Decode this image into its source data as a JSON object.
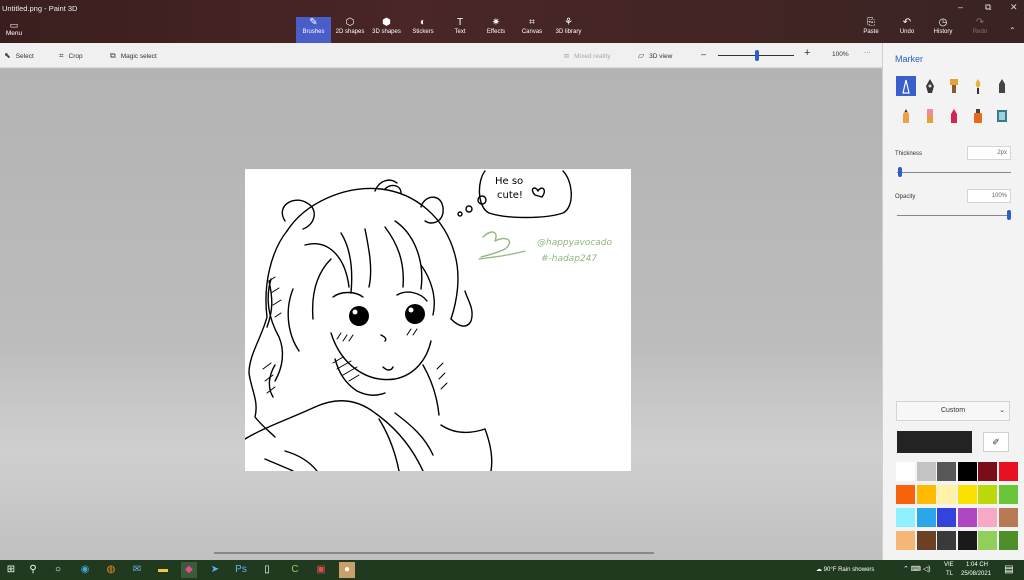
{
  "window": {
    "title": "Untitled.png - Paint 3D"
  },
  "ribbon": {
    "menu_label": "Menu",
    "tools": [
      {
        "label": "Brushes",
        "icon": "brush-icon",
        "glyph": "✎"
      },
      {
        "label": "2D shapes",
        "icon": "2d-shapes-icon",
        "glyph": "⬡"
      },
      {
        "label": "3D shapes",
        "icon": "3d-shapes-icon",
        "glyph": "⬢"
      },
      {
        "label": "Stickers",
        "icon": "stickers-icon",
        "glyph": "◐"
      },
      {
        "label": "Text",
        "icon": "text-icon",
        "glyph": "T"
      },
      {
        "label": "Effects",
        "icon": "effects-icon",
        "glyph": "✷"
      },
      {
        "label": "Canvas",
        "icon": "canvas-icon",
        "glyph": "⌗"
      },
      {
        "label": "3D library",
        "icon": "3d-library-icon",
        "glyph": "⚘"
      }
    ],
    "paste_label": "Paste",
    "undo_label": "Undo",
    "history_label": "History",
    "redo_label": "Redo"
  },
  "subbar": {
    "select_label": "Select",
    "crop_label": "Crop",
    "magic_select_label": "Magic select",
    "mixed_reality_label": "Mixed reality",
    "view3d_label": "3D view",
    "zoom_value": "100%",
    "more": "···"
  },
  "canvas_text": {
    "bubble_line1": "He so",
    "bubble_line2": "cute!",
    "handle": "@happyavocado",
    "hashtag": "#-hadap247"
  },
  "panel": {
    "title": "Marker",
    "thickness_label": "Thickness",
    "thickness_value": "2px",
    "thickness_level": 0.03,
    "opacity_label": "Opacity",
    "opacity_value": "100%",
    "opacity_level": 1.0,
    "palette_mode": "Custom",
    "current_color": "#232323",
    "swatches": [
      "#ffffff",
      "#c3c3c3",
      "#585858",
      "#000000",
      "#7a0d1a",
      "#e81123",
      "#f7630c",
      "#ffb900",
      "#fff1a8",
      "#fce100",
      "#bad80a",
      "#6bc53b",
      "#8ff0ff",
      "#2aa7e8",
      "#3344dd",
      "#b146c2",
      "#f7a8c7",
      "#b87a55",
      "#f6b675",
      "#6c4123",
      "#3a3a3a",
      "#1a1a1a",
      "#8fcf5a",
      "#4e8f2a"
    ]
  },
  "taskbar": {
    "weather": "90°F  Rain showers",
    "lang_line1": "VIE",
    "lang_line2": "TL",
    "time": "1:04 CH",
    "date": "25/08/2021"
  },
  "colors": {
    "accent": "#3a5ecb",
    "ribbon": "#3b2323",
    "taskbar": "#1f3a1e"
  }
}
